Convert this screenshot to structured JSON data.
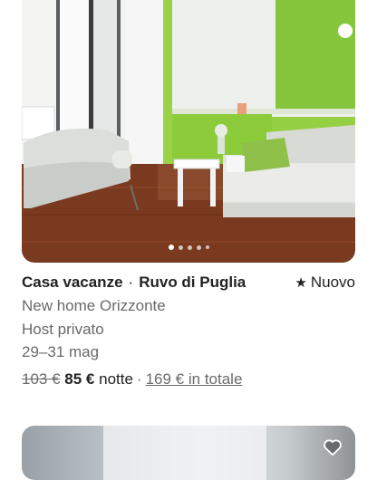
{
  "listing": {
    "type": "Casa vacanze",
    "separator": "·",
    "location": "Ruvo di Puglia",
    "badge": "Nuovo",
    "badge_icon": "star-icon",
    "name": "New home Orizzonte",
    "host": "Host privato",
    "dates": "29–31 mag",
    "price_old": "103 €",
    "price_new": "85 €",
    "price_unit": "notte",
    "price_sep": "·",
    "price_total": "169 € in totale",
    "photo_dots": 5,
    "active_dot": 0
  },
  "next_listing": {
    "heart_icon": "heart-outline-icon"
  },
  "colors": {
    "text_primary": "#222222",
    "text_secondary": "#6a6a6a",
    "wall_green": "#8ccb3a"
  }
}
